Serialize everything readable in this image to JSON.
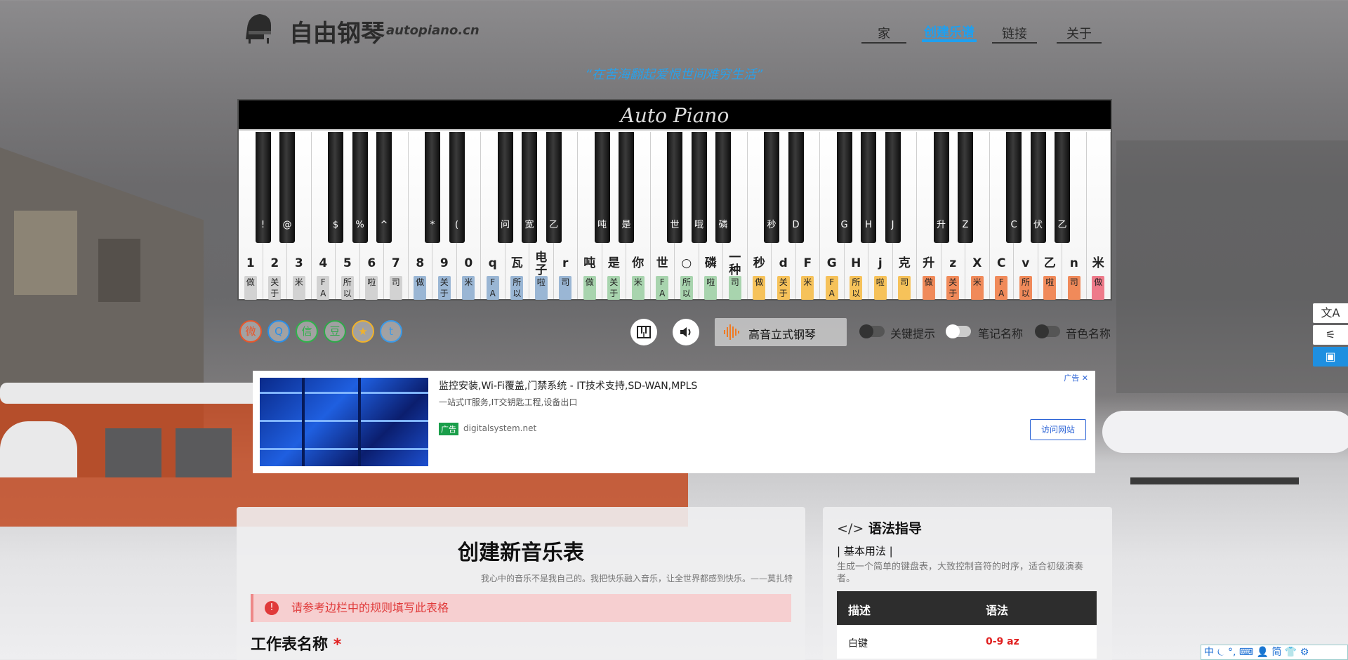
{
  "header": {
    "brand": "自由钢琴",
    "brand_en": "autopiano.cn",
    "nav": [
      "家",
      "创建乐谱",
      "链接",
      "关于"
    ]
  },
  "quote": "“在苦海翻起爱恨世间难穷生活”",
  "piano": {
    "title": "Auto Piano",
    "white_keys": [
      {
        "k": "1",
        "n": "做",
        "c": "#d2d2d2"
      },
      {
        "k": "2",
        "n": "关\n于",
        "c": "#d2d2d2"
      },
      {
        "k": "3",
        "n": "米",
        "c": "#d2d2d2"
      },
      {
        "k": "4",
        "n": "F\nA",
        "c": "#d2d2d2"
      },
      {
        "k": "5",
        "n": "所\n以",
        "c": "#d2d2d2"
      },
      {
        "k": "6",
        "n": "啦",
        "c": "#d2d2d2"
      },
      {
        "k": "7",
        "n": "司",
        "c": "#d2d2d2"
      },
      {
        "k": "8",
        "n": "做",
        "c": "#9ab6d4"
      },
      {
        "k": "9",
        "n": "关\n于",
        "c": "#9ab6d4"
      },
      {
        "k": "0",
        "n": "米",
        "c": "#9ab6d4"
      },
      {
        "k": "q",
        "n": "F\nA",
        "c": "#9ab6d4"
      },
      {
        "k": "瓦",
        "n": "所\n以",
        "c": "#9ab6d4"
      },
      {
        "k": "电子",
        "n": "啦",
        "c": "#9ab6d4"
      },
      {
        "k": "r",
        "n": "司",
        "c": "#9ab6d4"
      },
      {
        "k": "吨",
        "n": "做",
        "c": "#a8d4ae"
      },
      {
        "k": "是",
        "n": "关\n于",
        "c": "#a8d4ae"
      },
      {
        "k": "你",
        "n": "米",
        "c": "#a8d4ae"
      },
      {
        "k": "世",
        "n": "F\nA",
        "c": "#a8d4ae"
      },
      {
        "k": "○",
        "n": "所\n以",
        "c": "#a8d4ae"
      },
      {
        "k": "磷",
        "n": "啦",
        "c": "#a8d4ae"
      },
      {
        "k": "一种",
        "n": "司",
        "c": "#a8d4ae"
      },
      {
        "k": "秒",
        "n": "做",
        "c": "#f6c25a"
      },
      {
        "k": "d",
        "n": "关\n于",
        "c": "#f6c25a"
      },
      {
        "k": "F",
        "n": "米",
        "c": "#f6c25a"
      },
      {
        "k": "G",
        "n": "F\nA",
        "c": "#f6c25a"
      },
      {
        "k": "H",
        "n": "所\n以",
        "c": "#f6c25a"
      },
      {
        "k": "j",
        "n": "啦",
        "c": "#f6c25a"
      },
      {
        "k": "克",
        "n": "司",
        "c": "#f6c25a"
      },
      {
        "k": "升",
        "n": "做",
        "c": "#f08a5a"
      },
      {
        "k": "z",
        "n": "关\n于",
        "c": "#f08a5a"
      },
      {
        "k": "X",
        "n": "米",
        "c": "#f08a5a"
      },
      {
        "k": "C",
        "n": "F\nA",
        "c": "#f08a5a"
      },
      {
        "k": "v",
        "n": "所\n以",
        "c": "#f08a5a"
      },
      {
        "k": "乙",
        "n": "啦",
        "c": "#f08a5a"
      },
      {
        "k": "n",
        "n": "司",
        "c": "#f08a5a"
      },
      {
        "k": "米",
        "n": "做",
        "c": "#ee7a8a"
      }
    ],
    "black_keys": [
      "!",
      "@",
      "$",
      "%",
      "^",
      "*",
      "(",
      "问",
      "宽",
      "乙",
      "吨",
      "是",
      "世",
      "哦",
      "磷",
      "秒",
      "D",
      "G",
      "H",
      "J",
      "升",
      "Z",
      "C",
      "伏",
      "乙"
    ]
  },
  "social": [
    {
      "name": "weibo-icon",
      "glyph": "微",
      "color": "#e8562a"
    },
    {
      "name": "qq-icon",
      "glyph": "Q",
      "color": "#2a8fe8"
    },
    {
      "name": "wechat-icon",
      "glyph": "信",
      "color": "#2fb24a"
    },
    {
      "name": "douban-icon",
      "glyph": "豆",
      "color": "#2fa84a"
    },
    {
      "name": "qzone-icon",
      "glyph": "★",
      "color": "#f0b22a"
    },
    {
      "name": "twitter-icon",
      "glyph": "t",
      "color": "#3a9ae8"
    }
  ],
  "controls": {
    "sound": "高音立式钢琴",
    "toggles": [
      "关键提示",
      "笔记名称",
      "音色名称"
    ]
  },
  "ad": {
    "title": "监控安装,Wi-Fi覆盖,门禁系统 - IT技术支持,SD-WAN,MPLS",
    "sub": "一站式IT服务,IT交钥匙工程,设备出口",
    "tag": "广告",
    "site": "digitalsystem.net",
    "button": "访问网站",
    "label": "广告"
  },
  "form": {
    "title": "创建新音乐表",
    "motto": "我心中的音乐不是我自己的。我把快乐融入音乐，让全世界都感到快乐。——莫扎特",
    "alert": "请参考边栏中的规则填写此表格",
    "field": "工作表名称",
    "required": "*"
  },
  "sidebar": {
    "title": "语法指导",
    "subtitle": "| 基本用法 |",
    "desc": "生成一个简单的键盘表，大致控制音符的时序，适合初级演奏者。",
    "table": {
      "headers": [
        "描述",
        "语法"
      ],
      "rows": [
        [
          "白键",
          "0-9 az"
        ]
      ]
    }
  },
  "ime": "中 ⏾ °, ⌨ 👤 简 👕 ⚙"
}
